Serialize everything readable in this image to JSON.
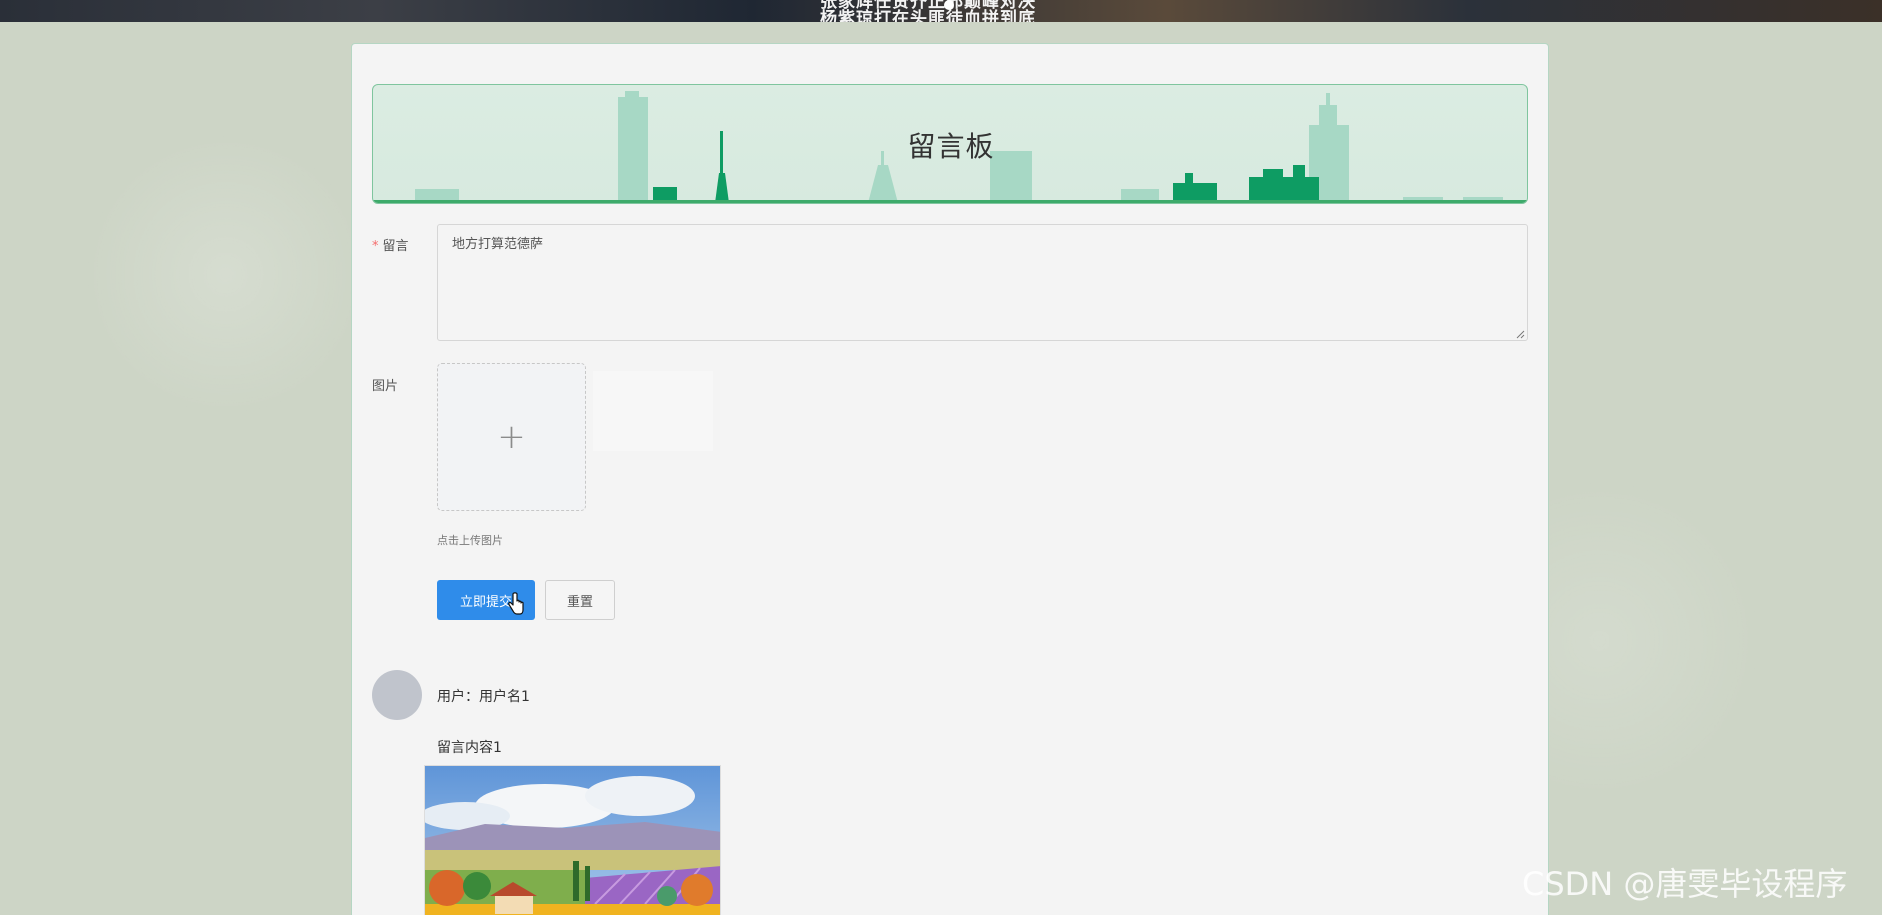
{
  "banner": {
    "line1": "张家辉任贤齐正邪巅峰对决",
    "line2": "杨紫琼打在头匪徒血拼到底"
  },
  "board": {
    "title": "留言板"
  },
  "form": {
    "message_label": "留言",
    "required_mark": "*",
    "message_value": "地方打算范德萨",
    "image_label": "图片",
    "upload_plus": "+",
    "upload_tip": "点击上传图片",
    "submit_label": "立即提交",
    "reset_label": "重置"
  },
  "messages": [
    {
      "user_text": "用户：用户名1",
      "content": "留言内容1"
    }
  ],
  "watermark": "CSDN @唐雯毕设程序",
  "colors": {
    "primary": "#2f8cea",
    "header_border": "#7fc59e",
    "skyline": "#0e9c63",
    "skyline_light": "#9fd6c0"
  },
  "icons": {
    "upload": "plus-icon",
    "cursor": "hand-pointer-icon"
  }
}
